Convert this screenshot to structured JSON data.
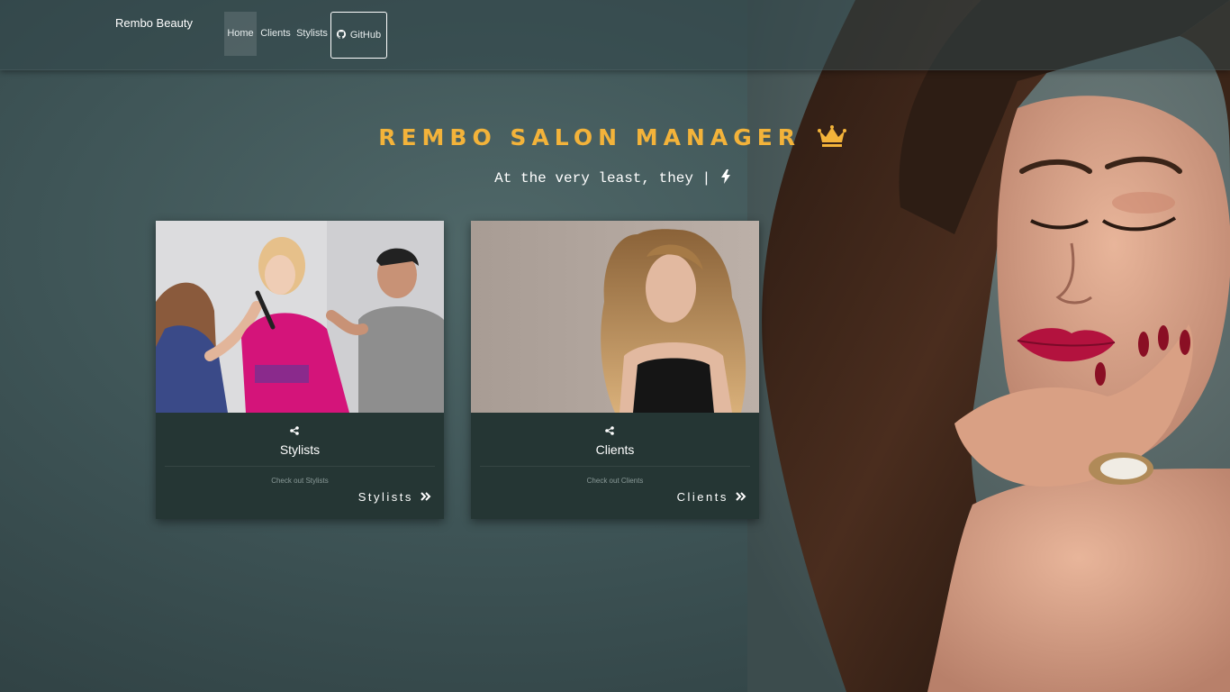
{
  "navbar": {
    "brand": "Rembo Beauty",
    "items": [
      {
        "label": "Home",
        "active": true
      },
      {
        "label": "Clients"
      },
      {
        "label": "Stylists"
      }
    ],
    "github": {
      "label": "GitHub",
      "icon": "github-icon"
    }
  },
  "hero": {
    "title": "REMBO SALON MANAGER",
    "title_icon": "crown-icon",
    "subtitle": "At the very least, they |",
    "subtitle_icon": "bolt-icon"
  },
  "cards": [
    {
      "title": "Stylists",
      "description": "Check out Stylists",
      "link_label": "Stylists",
      "icon": "share-icon",
      "image": "stylists-photo"
    },
    {
      "title": "Clients",
      "description": "Check out Clients",
      "link_label": "Clients",
      "icon": "share-icon",
      "image": "client-photo"
    }
  ],
  "colors": {
    "accent": "#f3b33a",
    "card_bg": "#253634",
    "page_bg": "#3e5456"
  }
}
